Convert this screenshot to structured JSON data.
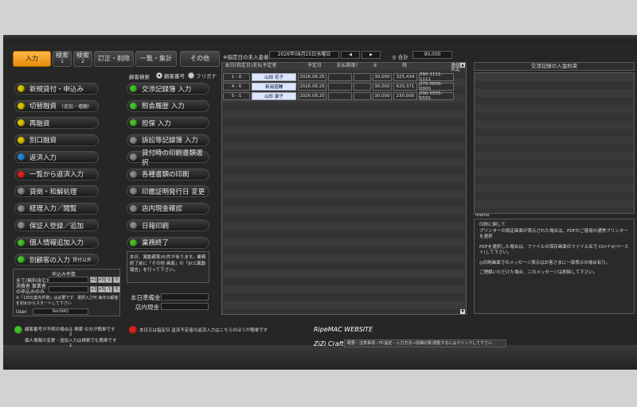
{
  "tabs": [
    {
      "label": "入力",
      "sub": "",
      "active": true
    },
    {
      "label": "検索",
      "sub": "1",
      "active": false
    },
    {
      "label": "検索",
      "sub": "2",
      "active": false
    },
    {
      "label": "訂正・削除",
      "sub": "",
      "active": false
    },
    {
      "label": "一覧・集計",
      "sub": "",
      "active": false
    },
    {
      "label": "その他",
      "sub": "",
      "active": false
    }
  ],
  "search_mode": {
    "label": "顧客検索",
    "opt1": "顧客番号",
    "opt2": "フリガナ"
  },
  "left_menu": [
    {
      "label": "新規貸付・申込み",
      "note": "",
      "color": "#d8c300"
    },
    {
      "label": "切替融資",
      "note": "（追加・増額）",
      "color": "#d8c300"
    },
    {
      "label": "再融資",
      "note": "",
      "color": "#d8c300"
    },
    {
      "label": "別口融資",
      "note": "",
      "color": "#d8c300"
    },
    {
      "label": "返済入力",
      "note": "",
      "color": "#1e88d6"
    },
    {
      "label": "一覧から返済入力",
      "note": "",
      "color": "#e02020"
    },
    {
      "label": "貸倒・和解処理",
      "note": "",
      "color": "#8a8a8a"
    },
    {
      "label": "経理入力／閲覧",
      "note": "",
      "color": "#8a8a8a"
    },
    {
      "label": "保証人登録／追加",
      "note": "",
      "color": "#8a8a8a"
    },
    {
      "label": "個人情報追加入力",
      "note": "",
      "color": "#43c02a"
    },
    {
      "label": "別顧客の入力",
      "note": "貸付以外",
      "color": "#43c02a"
    }
  ],
  "right_menu": [
    {
      "label": "交渉記録簿 入力",
      "color": "#43c02a"
    },
    {
      "label": "照会履歴 入力",
      "color": "#43c02a"
    },
    {
      "label": "担保 入力",
      "color": "#43c02a"
    },
    {
      "label": "訴訟等記録簿 入力",
      "color": "#8a8a8a"
    },
    {
      "label": "貸付時の印刷書類選択",
      "color": "#8a8a8a"
    },
    {
      "label": "各種書類の印刷",
      "color": "#8a8a8a"
    },
    {
      "label": "印鑑証明発行日 変更",
      "color": "#8a8a8a"
    },
    {
      "label": "店内現金確認",
      "color": "#8a8a8a"
    },
    {
      "label": "日報印刷",
      "color": "#8a8a8a"
    },
    {
      "label": "業務終了",
      "color": "#43c02a"
    }
  ],
  "info_note": "本日、異動顧客(6)件があります。業務終了前に「その他 画面」の「JICC異動報告」を行って下さい。",
  "apply_panel": {
    "title": "申込み件数",
    "row1_label": "全て(無料含む)",
    "row2_label": "消費者 事業者の申込みのみ",
    "buttons": [
      "+1",
      "+5",
      "-1",
      "-5"
    ],
    "note": "※「1日の案内件数」は必要です、選択入力可 毎年の顧客を初めからスタートして下さい",
    "user_label": "User",
    "user_value": "RenNAO"
  },
  "cash": {
    "reserve_label": "本日準備金",
    "store_label": "店内現金"
  },
  "date_bar": {
    "label": "※指定日の未入金者",
    "date": "2026年08月25日水曜日",
    "total_label": "◎ 合計",
    "total_value": "90,000",
    "nav_prev": "◀",
    "nav_next": "▶"
  },
  "table": {
    "headers": [
      "本日(指定日)支払予定者",
      "",
      "予定日",
      "支払期限?",
      "④",
      "残",
      "",
      "連絡\n未定"
    ],
    "rows": [
      {
        "no": "1 - 0",
        "name": "山田 花子",
        "date": "2026.08.25",
        "amount": "30,000",
        "balance": "325,434",
        "phone": "090-1111-1111"
      },
      {
        "no": "4 - 0",
        "name": "新潟道輔",
        "date": "2026.08.25",
        "amount": "30,000",
        "balance": "620,371",
        "phone": "070-0000-0000"
      },
      {
        "no": "5 - 1",
        "name": "山形 康子",
        "date": "2026.08.25",
        "amount": "30,000",
        "balance": "230,000",
        "phone": "090-5555-5555"
      }
    ]
  },
  "right_panel": {
    "title": "交渉記録の入金約束",
    "memo_label": "memo",
    "memo_lines": [
      "印刷に関して",
      "プリンターの設定画面が表示された場合は、PDFかご使用の通常プリンターを選択",
      "PDFを選択した場合は、ファイルの保存画面のファイル名で Ctrl＋V(ペースト)して下さい。",
      "◎印刷画面でのメッセージ表示はお客さまに一部表示の場合有り。",
      "ご理解いただけた場合、このメッセージは削除して下さい。"
    ]
  },
  "footer": {
    "green_note": "顧客番号が不明の場合は 検索 の方が簡単です",
    "green_num": "2",
    "green_note2": "個人情報の変更・追加入力は検索でも簡単です",
    "green_num2": "1",
    "red_note": "本日又は指定日 返済予定者の返済入力はこちらのほうが簡単です",
    "site": "RipeMAC WEBSITE",
    "craft": "ZiZi Craft",
    "craft_msg": "概要・注意事項・PC設定・入力方法→詳細の場 閲覧するにはクリックして下さい"
  },
  "colors": {
    "accent": "#f39a10",
    "bg": "#262626"
  }
}
